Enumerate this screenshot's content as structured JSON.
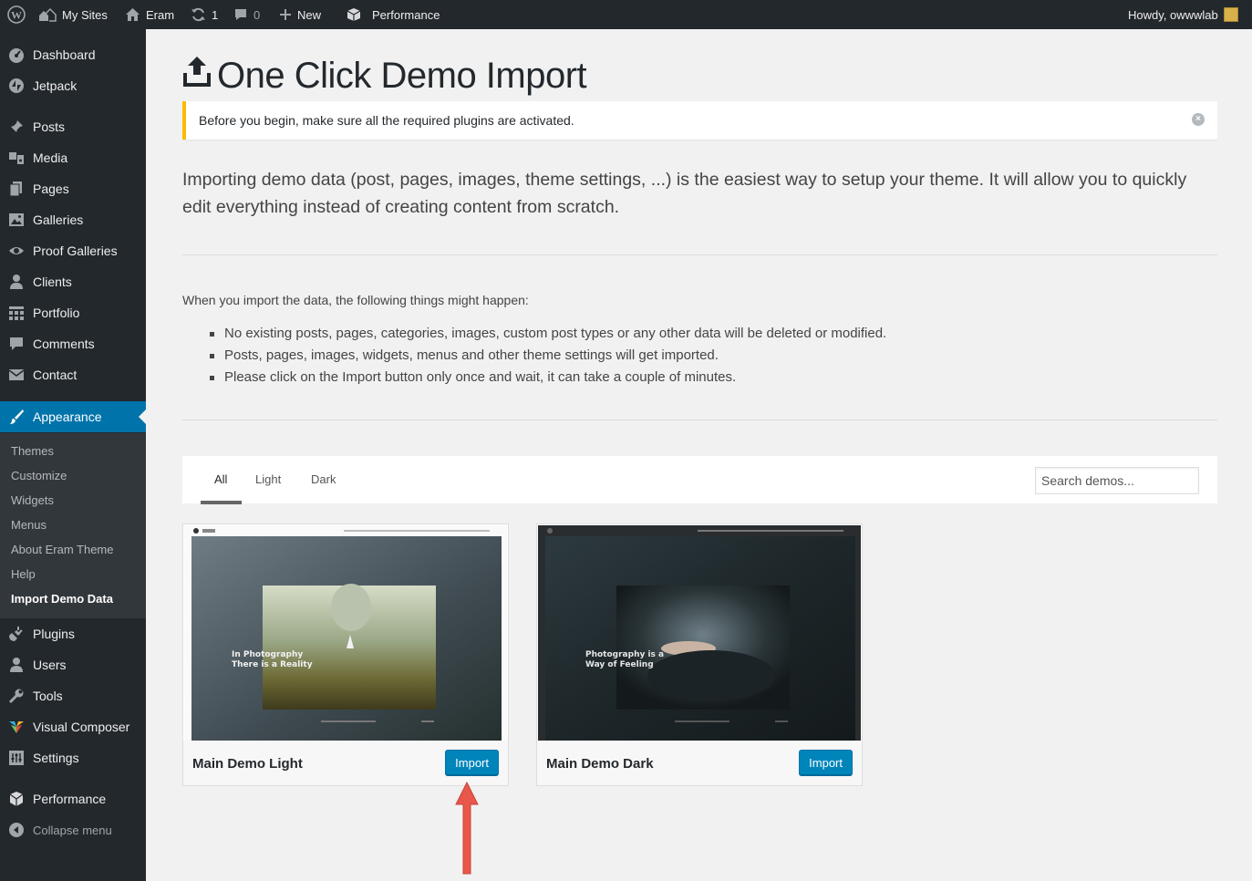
{
  "adminbar": {
    "my_sites": "My Sites",
    "site_name": "Eram",
    "updates_count": "1",
    "comments_count": "0",
    "new_label": "New",
    "performance_label": "Performance",
    "howdy": "Howdy, owwwlab"
  },
  "sidebar": {
    "items": [
      {
        "label": "Dashboard",
        "icon": "dashboard-icon"
      },
      {
        "label": "Jetpack",
        "icon": "jetpack-icon"
      },
      {
        "label": "Posts",
        "icon": "pin-icon"
      },
      {
        "label": "Media",
        "icon": "media-icon"
      },
      {
        "label": "Pages",
        "icon": "pages-icon"
      },
      {
        "label": "Galleries",
        "icon": "image-icon"
      },
      {
        "label": "Proof Galleries",
        "icon": "eye-icon"
      },
      {
        "label": "Clients",
        "icon": "user-icon"
      },
      {
        "label": "Portfolio",
        "icon": "grid-icon"
      },
      {
        "label": "Comments",
        "icon": "comment-icon"
      },
      {
        "label": "Contact",
        "icon": "mail-icon"
      },
      {
        "label": "Appearance",
        "icon": "brush-icon"
      },
      {
        "label": "Plugins",
        "icon": "plug-icon"
      },
      {
        "label": "Users",
        "icon": "users-icon"
      },
      {
        "label": "Tools",
        "icon": "wrench-icon"
      },
      {
        "label": "Visual Composer",
        "icon": "vc-icon"
      },
      {
        "label": "Settings",
        "icon": "settings-icon"
      },
      {
        "label": "Performance",
        "icon": "performance-icon"
      },
      {
        "label": "Collapse menu",
        "icon": "collapse-icon"
      }
    ],
    "submenu": [
      {
        "label": "Themes"
      },
      {
        "label": "Customize"
      },
      {
        "label": "Widgets"
      },
      {
        "label": "Menus"
      },
      {
        "label": "About Eram Theme"
      },
      {
        "label": "Help"
      },
      {
        "label": "Import Demo Data"
      }
    ]
  },
  "main": {
    "title": "One Click Demo Import",
    "notice": "Before you begin, make sure all the required plugins are activated.",
    "intro": "Importing demo data (post, pages, images, theme settings, ...) is the easiest way to setup your theme. It will allow you to quickly edit everything instead of creating content from scratch.",
    "info_title": "When you import the data, the following things might happen:",
    "info_items": [
      "No existing posts, pages, categories, images, custom post types or any other data will be deleted or modified.",
      "Posts, pages, images, widgets, menus and other theme settings will get imported.",
      "Please click on the Import button only once and wait, it can take a couple of minutes."
    ],
    "filters": {
      "tabs": [
        "All",
        "Light",
        "Dark"
      ],
      "active": "All",
      "search_placeholder": "Search demos..."
    },
    "demos": [
      {
        "name": "Main Demo Light",
        "button": "Import",
        "thumb_text": [
          "In Photography",
          "There is a Reality"
        ]
      },
      {
        "name": "Main Demo Dark",
        "button": "Import",
        "thumb_text": [
          "Photography is a",
          "Way of Feeling"
        ]
      }
    ]
  },
  "colors": {
    "admin_bar": "#23282d",
    "accent": "#0073aa",
    "button": "#0085ba",
    "notice_border": "#ffb900",
    "arrow": "#e8574a"
  }
}
